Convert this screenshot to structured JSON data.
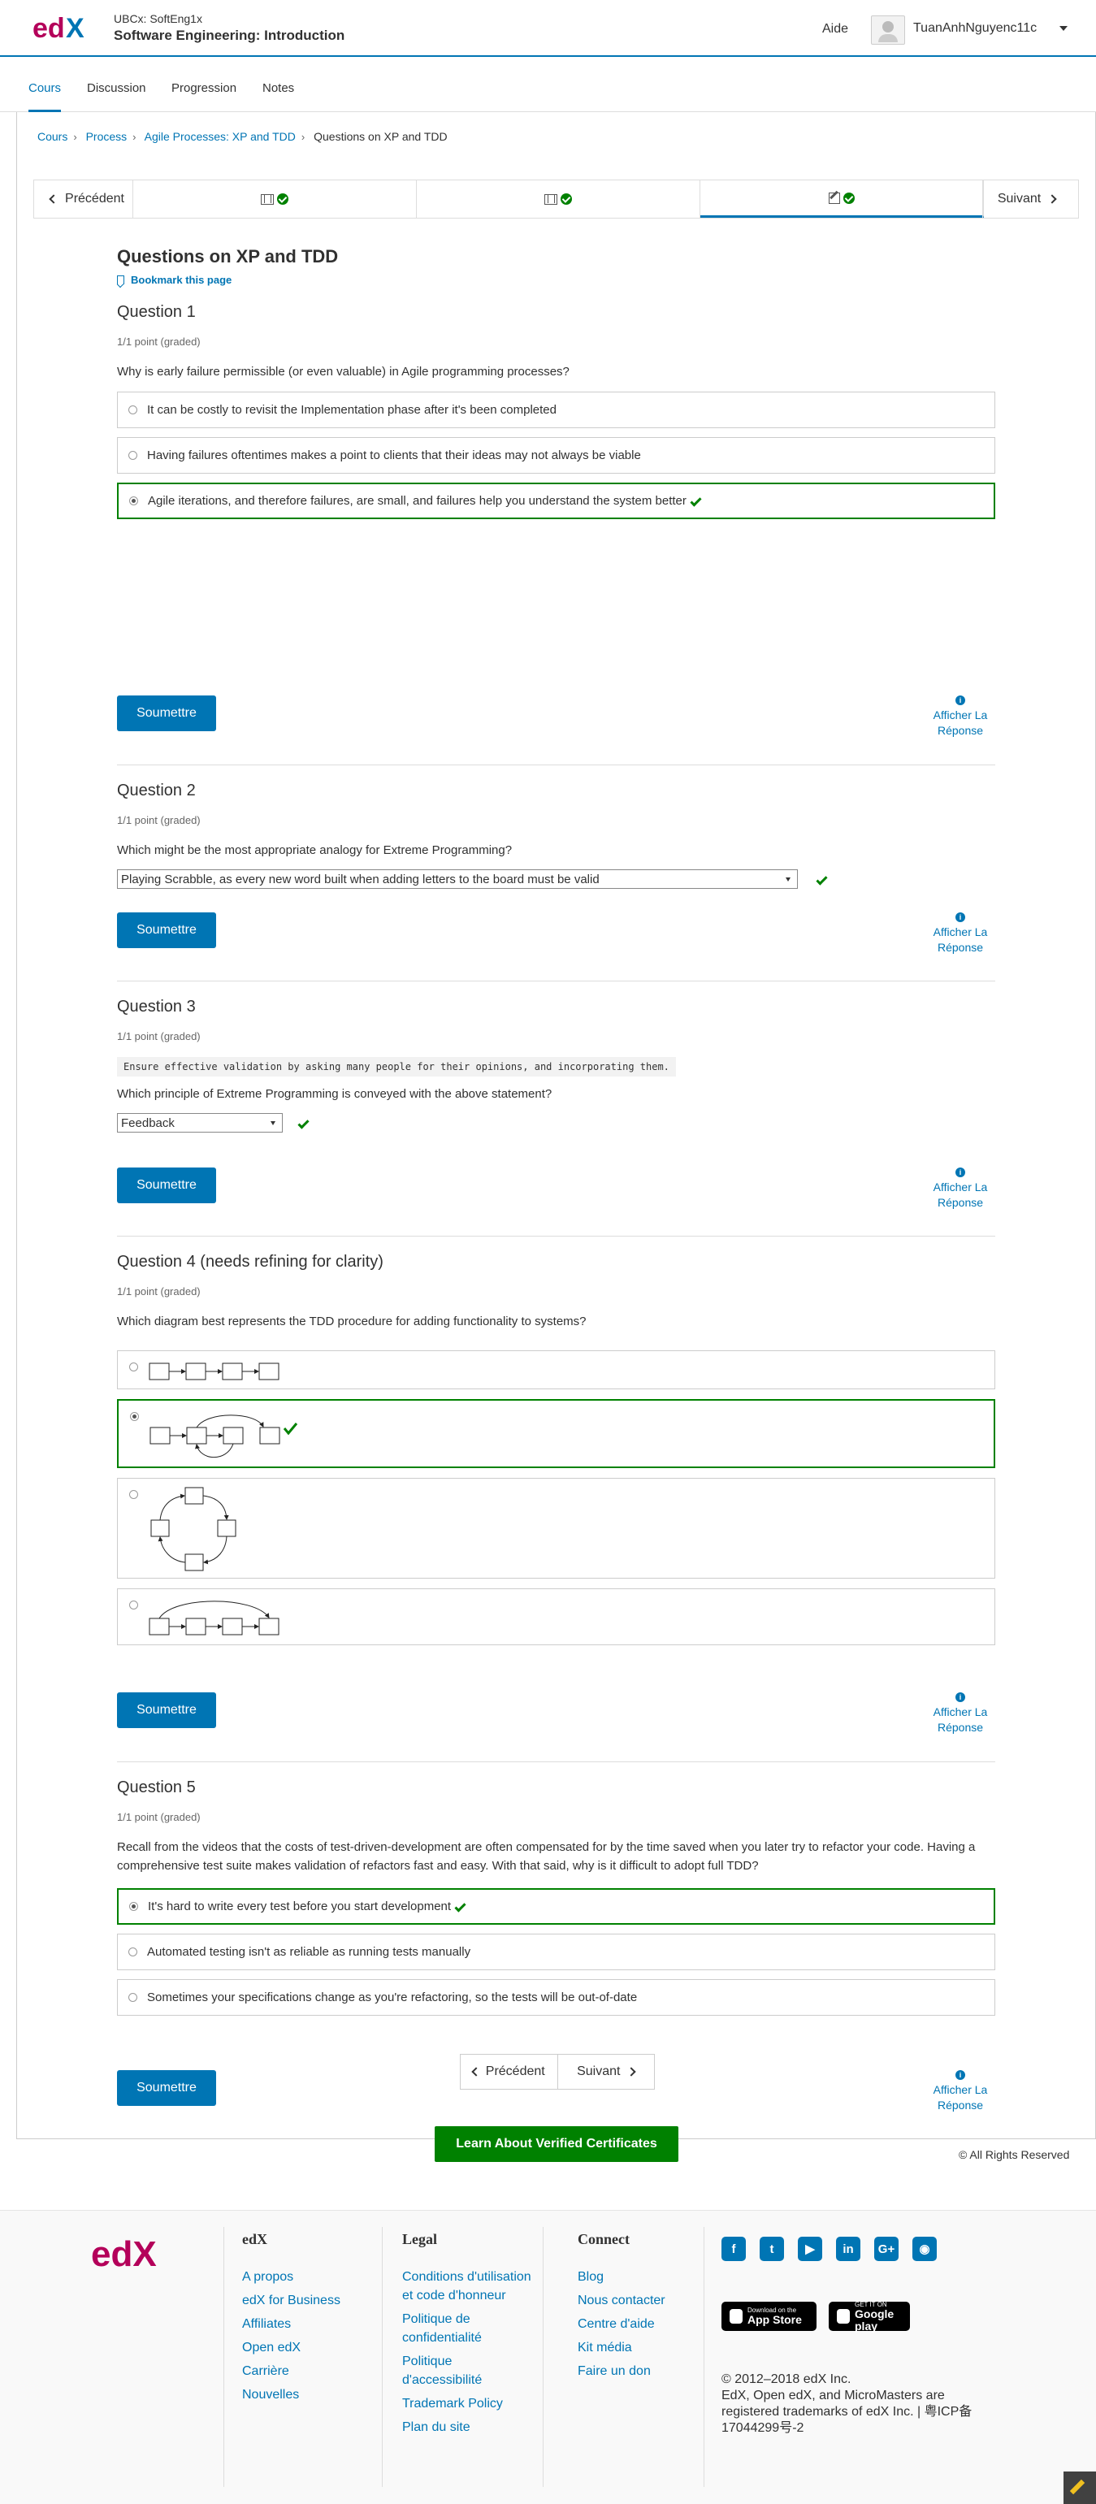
{
  "header": {
    "course_org": "UBCx: SoftEng1x",
    "course_title": "Software Engineering: Introduction",
    "help": "Aide",
    "username": "TuanAnhNguyenc11c"
  },
  "tabs": [
    "Cours",
    "Discussion",
    "Progression",
    "Notes"
  ],
  "breadcrumb": [
    "Cours",
    "Process",
    "Agile Processes: XP and TDD",
    "Questions on XP and TDD"
  ],
  "sequence_nav": {
    "prev": "Précédent",
    "next": "Suivant"
  },
  "page": {
    "title": "Questions on XP and TDD",
    "bookmark": "Bookmark this page"
  },
  "common": {
    "submit": "Soumettre",
    "show_answer": "Afficher La Réponse",
    "info_icon": "i"
  },
  "questions": [
    {
      "title": "Question 1",
      "points": "1/1 point (graded)",
      "text": "Why is early failure permissible (or even valuable) in Agile programming processes?",
      "choices": [
        "It can be costly to revisit the Implementation phase after it's been completed",
        "Having failures oftentimes makes a point to clients that their ideas may not always be viable",
        "Agile iterations, and therefore failures, are small, and failures help you understand the system better"
      ]
    },
    {
      "title": "Question 2",
      "points": "1/1 point (graded)",
      "text": "Which might be the most appropriate analogy for Extreme Programming?",
      "selected": "Playing Scrabble, as every new word built when adding letters to the board must be valid"
    },
    {
      "title": "Question 3",
      "points": "1/1 point (graded)",
      "code": "Ensure effective validation by asking many people for their opinions, and incorporating them.",
      "text": "Which principle of Extreme Programming is conveyed with the above statement?",
      "selected": "Feedback"
    },
    {
      "title": "Question 4 (needs refining for clarity)",
      "points": "1/1 point (graded)",
      "text": "Which diagram best represents the TDD procedure for adding functionality to systems?"
    },
    {
      "title": "Question 5",
      "points": "1/1 point (graded)",
      "text": "Recall from the videos that the costs of test-driven-development are often compensated for by the time saved when you later try to refactor your code. Having a comprehensive test suite makes validation of refactors fast and easy. With that said, why is it difficult to adopt full TDD?",
      "choices": [
        "It's hard to write every test before you start development",
        "Automated testing isn't as reliable as running tests manually",
        "Sometimes your specifications change as you're refactoring, so the tests will be out-of-date"
      ]
    }
  ],
  "certificate_button": "Learn About Verified Certificates",
  "rights": "© All Rights Reserved",
  "footer": {
    "logo_text": "edX",
    "col_edx": {
      "title": "edX",
      "links": [
        "A propos",
        "edX for Business",
        "Affiliates",
        "Open edX",
        "Carrière",
        "Nouvelles"
      ]
    },
    "col_legal": {
      "title": "Legal",
      "links": [
        "Conditions d'utilisation et code d'honneur",
        "Politique de confidentialité",
        "Politique d'accessibilité",
        "Trademark Policy",
        "Plan du site"
      ]
    },
    "col_connect": {
      "title": "Connect",
      "links": [
        "Blog",
        "Nous contacter",
        "Centre d'aide",
        "Kit média",
        "Faire un don"
      ]
    },
    "social": [
      "facebook-icon",
      "twitter-icon",
      "youtube-icon",
      "linkedin-icon",
      "google-plus-icon",
      "reddit-icon"
    ],
    "app_store": {
      "small": "Download on the",
      "big": "App Store"
    },
    "google_play": {
      "small": "GET IT ON",
      "big": "Google play"
    },
    "copyright": "© 2012–2018 edX Inc.",
    "trademark": "EdX, Open edX, and MicroMasters are registered trademarks of edX Inc. | 粤ICP备17044299号-2"
  },
  "colors": {
    "primary": "#0075b4",
    "success": "#008100",
    "logo_red": "#b4005a"
  }
}
